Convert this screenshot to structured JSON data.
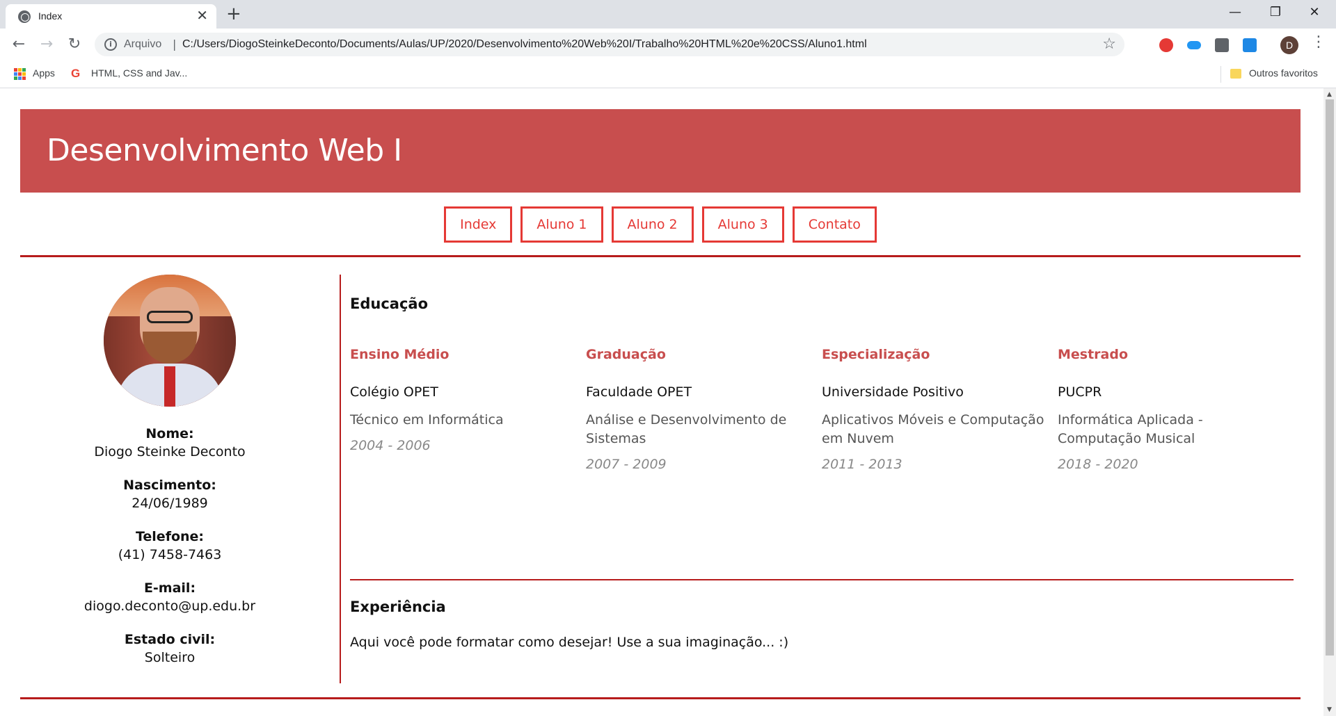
{
  "browser": {
    "tab_title": "Index",
    "close_glyph": "✕",
    "new_tab_glyph": "+",
    "scheme_label": "Arquivo",
    "url": "C:/Users/DiogoSteinkeDeconto/Documents/Aulas/UP/2020/Desenvolvimento%20Web%20I/Trabalho%20HTML%20e%20CSS/Aluno1.html",
    "profile_initial": "D",
    "bookmarks": [
      {
        "label": "Apps",
        "icon": "apps-grid-icon"
      },
      {
        "label": "HTML, CSS and Jav...",
        "icon": "google-icon"
      }
    ],
    "other_bookmarks": "Outros favoritos"
  },
  "site": {
    "title": "Desenvolvimento Web I",
    "nav": [
      "Index",
      "Aluno 1",
      "Aluno 2",
      "Aluno 3",
      "Contato"
    ],
    "accent": "#c84e4e",
    "nav_color": "#e53935",
    "rule_color": "#b71c1c"
  },
  "profile": {
    "photo_alt": "profile-photo",
    "fields": [
      {
        "label": "Nome:",
        "value": "Diogo Steinke Deconto"
      },
      {
        "label": "Nascimento:",
        "value": "24/06/1989"
      },
      {
        "label": "Telefone:",
        "value": "(41) 7458-7463"
      },
      {
        "label": "E-mail:",
        "value": "diogo.deconto@up.edu.br"
      },
      {
        "label": "Estado civil:",
        "value": "Solteiro"
      }
    ]
  },
  "education": {
    "heading": "Educação",
    "items": [
      {
        "level": "Ensino Médio",
        "institution": "Colégio OPET",
        "course": "Técnico em Informática",
        "years": "2004 - 2006"
      },
      {
        "level": "Graduação",
        "institution": "Faculdade OPET",
        "course": "Análise e Desenvolvimento de Sistemas",
        "years": "2007 - 2009"
      },
      {
        "level": "Especialização",
        "institution": "Universidade Positivo",
        "course": "Aplicativos Móveis e Computação em Nuvem",
        "years": "2011 - 2013"
      },
      {
        "level": "Mestrado",
        "institution": "PUCPR",
        "course": "Informática Aplicada - Computação Musical",
        "years": "2018 - 2020"
      }
    ]
  },
  "experience": {
    "heading": "Experiência",
    "text": "Aqui você pode formatar como desejar! Use a sua imaginação... :)"
  }
}
